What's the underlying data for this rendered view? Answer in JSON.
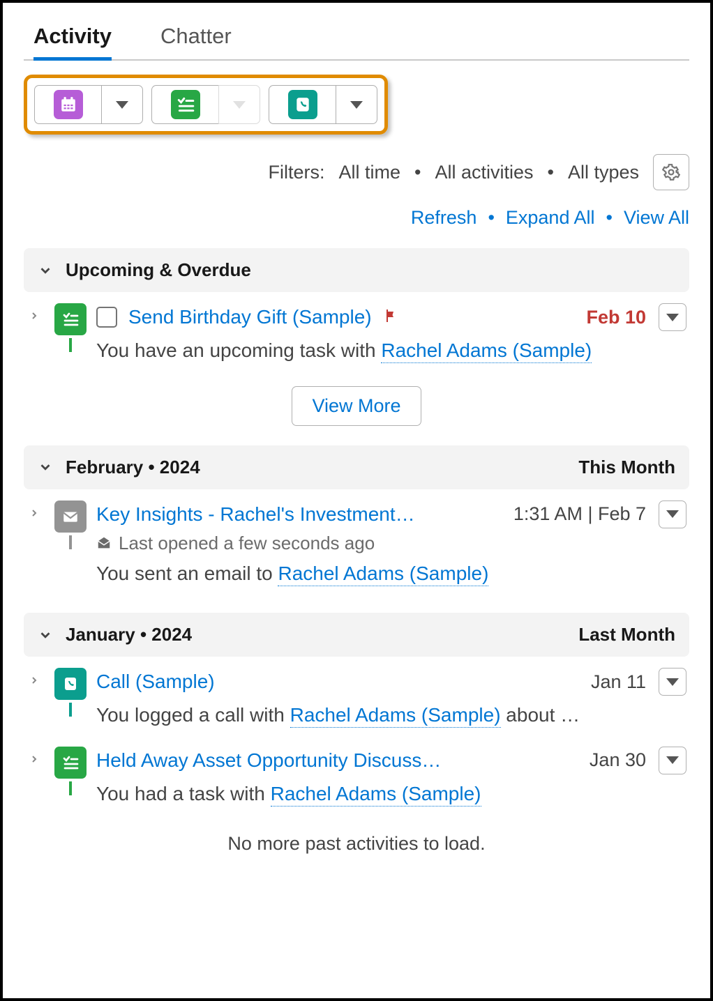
{
  "tabs": {
    "activity": "Activity",
    "chatter": "Chatter"
  },
  "action_buttons": {
    "calendar": "new-event",
    "task": "new-task",
    "call": "log-call"
  },
  "filters": {
    "label": "Filters:",
    "time": "All time",
    "activities": "All activities",
    "types": "All types"
  },
  "links": {
    "refresh": "Refresh",
    "expand_all": "Expand All",
    "view_all": "View All"
  },
  "sections": {
    "upcoming": {
      "title": "Upcoming & Overdue"
    },
    "feb": {
      "title": "February  •  2024",
      "sub": "This Month"
    },
    "jan": {
      "title": "January  •  2024",
      "sub": "Last Month"
    }
  },
  "items": {
    "birthday": {
      "title": "Send Birthday Gift (Sample)",
      "date": "Feb 10",
      "desc_pre": "You have an upcoming task with ",
      "contact": "Rachel Adams (Sample)"
    },
    "view_more": "View More",
    "insights": {
      "title": "Key Insights - Rachel's Investments (…",
      "date": "1:31 AM | Feb 7",
      "opened": "Last opened a few seconds ago",
      "desc_pre": "You sent an email to ",
      "contact": "Rachel Adams (Sample)"
    },
    "call": {
      "title": "Call (Sample)",
      "date": "Jan 11",
      "desc_pre": "You logged a call with ",
      "contact": "Rachel Adams (Sample)",
      "desc_post": " about …"
    },
    "held": {
      "title": "Held Away Asset Opportunity Discuss…",
      "date": "Jan 30",
      "desc_pre": "You had a task with ",
      "contact": "Rachel Adams (Sample)"
    }
  },
  "no_more": "No more past activities to load."
}
